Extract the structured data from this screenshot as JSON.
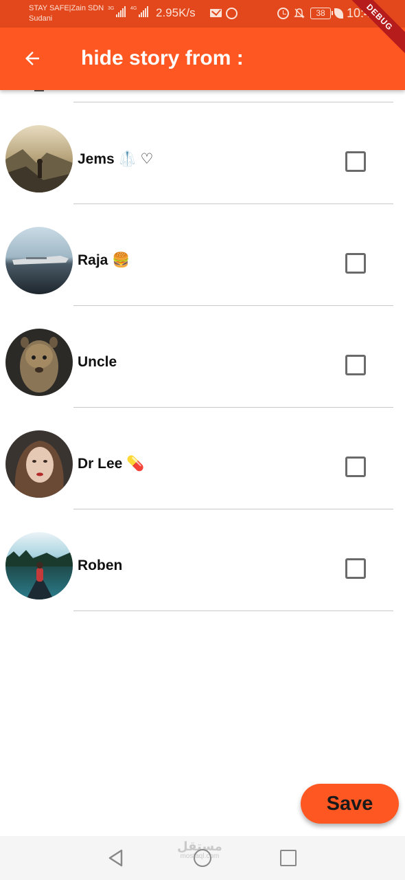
{
  "status_bar": {
    "carrier_line1": "STAY SAFE|Zain SDN",
    "carrier_line2": "Sudani",
    "network1": "3G",
    "network2": "4G",
    "speed": "2.95K/s",
    "battery": "38",
    "time": "10:41",
    "icons": [
      "signal-icon",
      "mail-icon",
      "whatsapp-icon",
      "alarm-icon",
      "mute-icon",
      "battery-icon",
      "leaf-icon"
    ]
  },
  "debug_banner": "DEBUG",
  "app_bar": {
    "title": "hide story from :",
    "back_icon": "arrow-back-icon"
  },
  "contacts": [
    {
      "name": "Jems 🥼 ♡",
      "checked": false
    },
    {
      "name": "Raja 🍔",
      "checked": false
    },
    {
      "name": "Uncle",
      "checked": false
    },
    {
      "name": "Dr Lee 💊",
      "checked": false
    },
    {
      "name": "Roben",
      "checked": false
    }
  ],
  "save_label": "Save",
  "nav_bar": {
    "watermark": "مستقل",
    "watermark_sub": "mostaql.com",
    "icons": [
      "nav-back-icon",
      "nav-home-icon",
      "nav-recent-icon"
    ]
  },
  "colors": {
    "status_bar": "#E2481B",
    "primary": "#FF5722",
    "debug": "#B71C1C"
  }
}
